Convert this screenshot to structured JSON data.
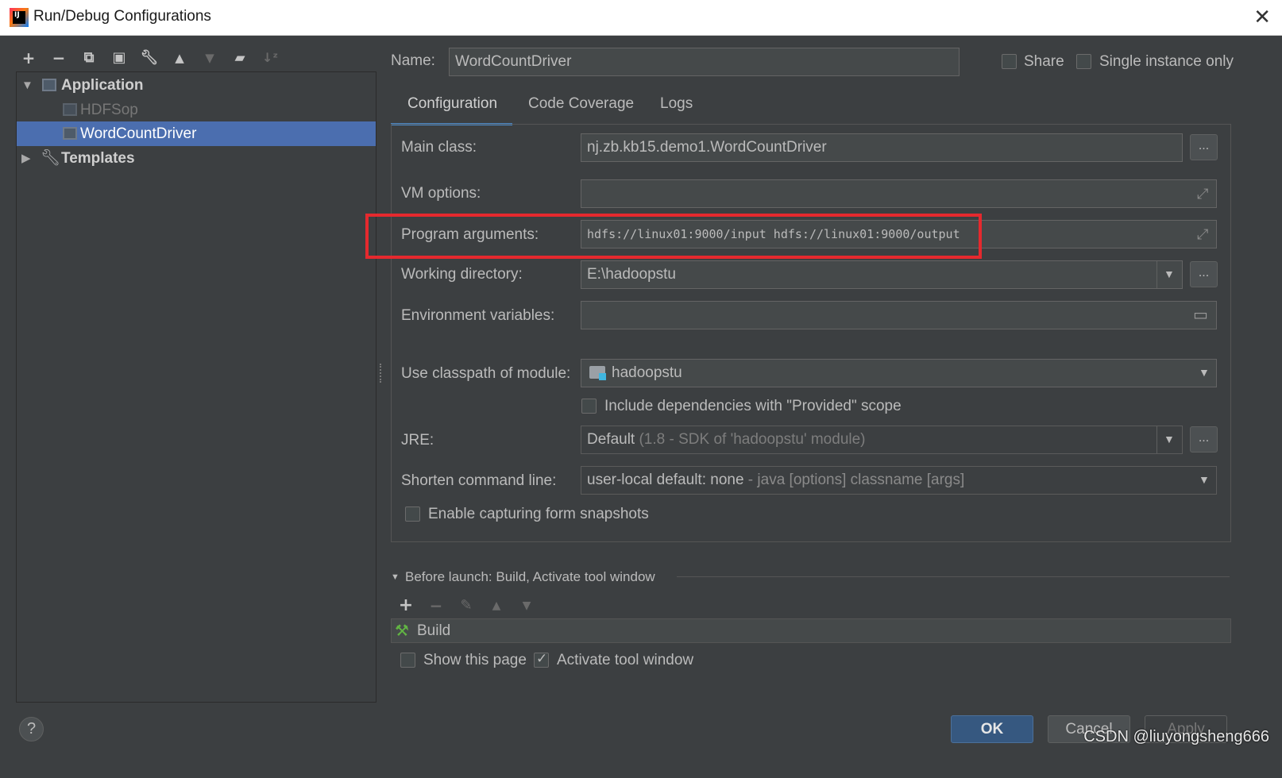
{
  "window": {
    "title": "Run/Debug Configurations",
    "app_icon_text": "IJ"
  },
  "toolbar": {
    "icons": [
      "plus-icon",
      "minus-icon",
      "copy-icon",
      "save-icon",
      "wrench-icon",
      "arrow-up-icon",
      "arrow-down-icon",
      "folder-add-icon",
      "sort-az-icon"
    ]
  },
  "tree": {
    "application": "Application",
    "children": [
      "HDFSop",
      "WordCountDriver"
    ],
    "templates": "Templates"
  },
  "header": {
    "name_label": "Name:",
    "name_value": "WordCountDriver",
    "share_label": "Share",
    "single_instance_label": "Single instance only"
  },
  "tabs": [
    "Configuration",
    "Code Coverage",
    "Logs"
  ],
  "form": {
    "main_class_label": "Main class:",
    "main_class_value": "nj.zb.kb15.demo1.WordCountDriver",
    "vm_options_label": "VM options:",
    "vm_options_value": "",
    "program_args_label": "Program arguments:",
    "program_args_value": "hdfs://linux01:9000/input hdfs://linux01:9000/output",
    "working_dir_label": "Working directory:",
    "working_dir_value": "E:\\hadoopstu",
    "env_vars_label": "Environment variables:",
    "env_vars_value": "",
    "classpath_label": "Use classpath of module:",
    "classpath_value": "hadoopstu",
    "include_deps_label": "Include dependencies with \"Provided\" scope",
    "jre_label": "JRE:",
    "jre_value": "Default",
    "jre_hint": "(1.8 - SDK of 'hadoopstu' module)",
    "shorten_label": "Shorten command line:",
    "shorten_value": "user-local default: none",
    "shorten_hint": "- java [options] classname [args]",
    "snapshots_label": "Enable capturing form snapshots",
    "browse_label": "..."
  },
  "before_launch": {
    "title": "Before launch: Build, Activate tool window",
    "items": [
      "Build"
    ],
    "show_page_label": "Show this page",
    "activate_label": "Activate tool window",
    "show_page_checked": false,
    "activate_checked": true
  },
  "buttons": {
    "ok": "OK",
    "cancel": "Cancel",
    "apply": "Apply",
    "help": "?"
  },
  "watermark": "CSDN @liuyongsheng666",
  "colors": {
    "background": "#3c3f41",
    "selection": "#4b6eaf",
    "accent": "#4a88c7",
    "highlight": "#e5292e",
    "primary_button": "#365880"
  }
}
